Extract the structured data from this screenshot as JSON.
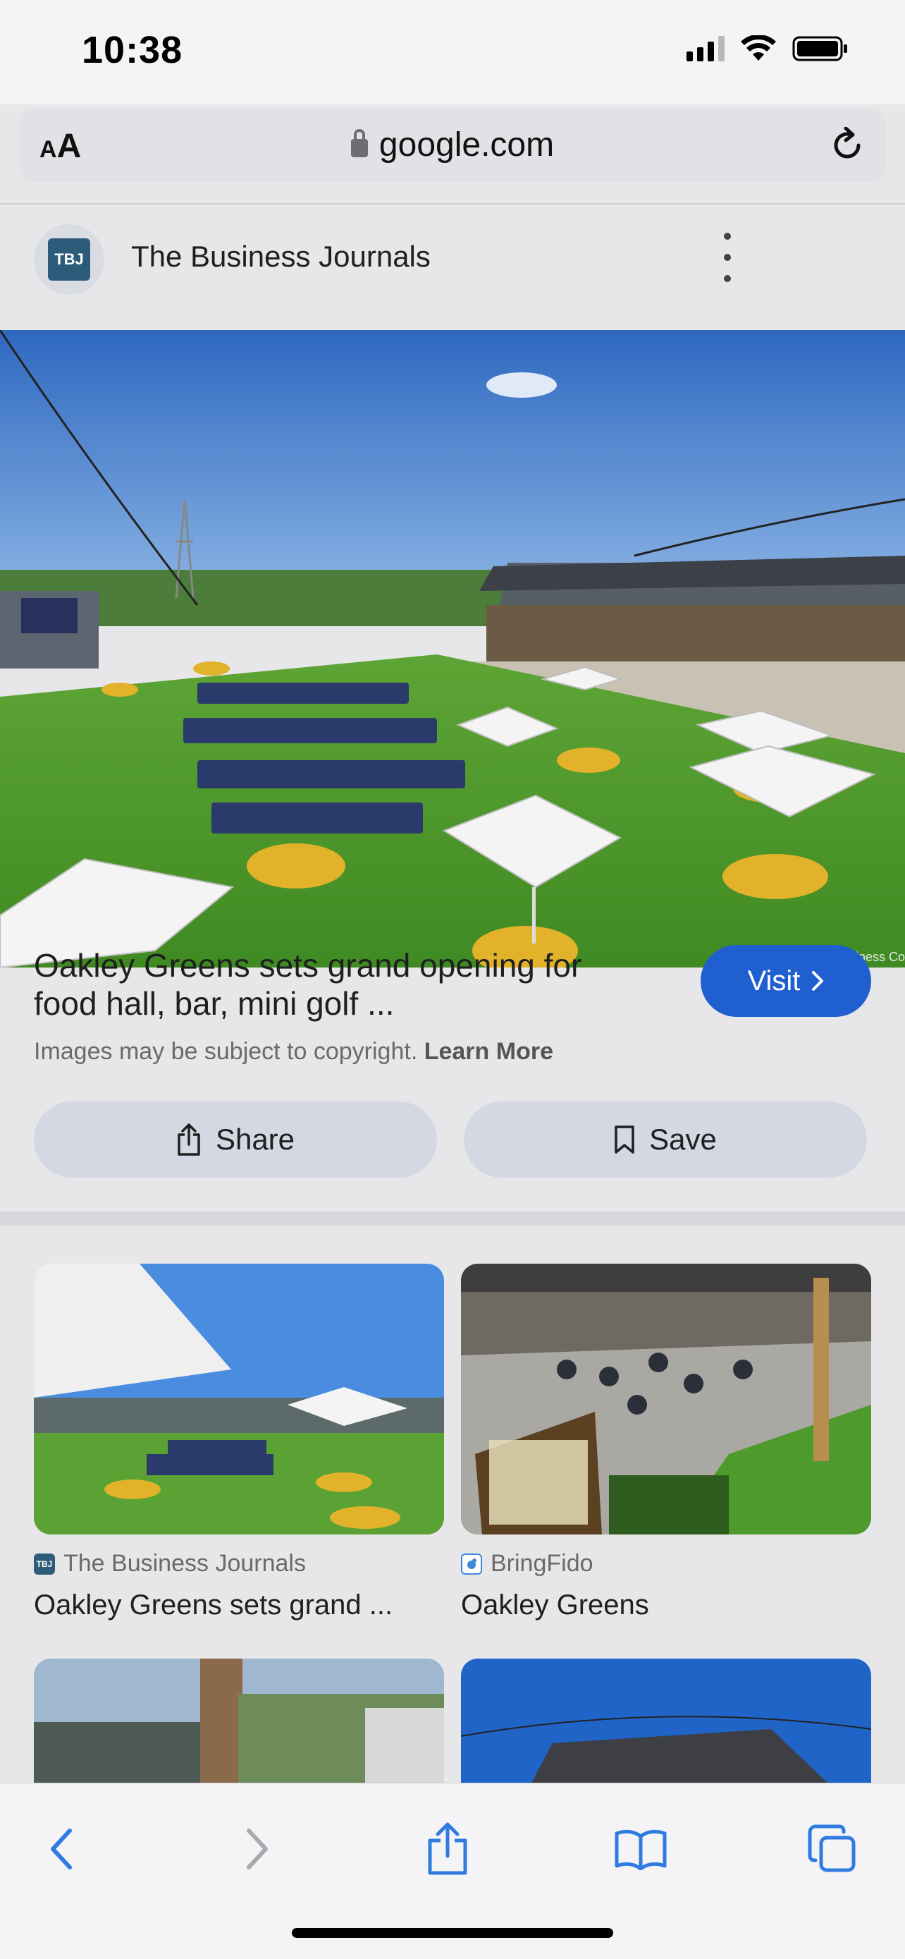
{
  "status_bar": {
    "time": "10:38"
  },
  "browser": {
    "text_size_label": "AA",
    "url": "google.com"
  },
  "source": {
    "logo_text": "TBJ",
    "name": "The Business Journals"
  },
  "hero": {
    "credit": "Image: Cincinnati Business Co"
  },
  "result": {
    "title_line1_partial": "Oakley Greens sets grand opening for",
    "title_line2": "food hall, bar, mini golf ...",
    "visit_label": "Visit",
    "copyright_text": "Images may be subject to copyright.",
    "learn_more": "Learn More",
    "share_label": "Share",
    "save_label": "Save"
  },
  "related": [
    {
      "source": "The Business Journals",
      "favicon": "TBJ",
      "title": "Oakley Greens sets grand ..."
    },
    {
      "source": "BringFido",
      "favicon": "dog-icon",
      "title": "Oakley Greens"
    }
  ],
  "colors": {
    "accent": "#1f5fd0",
    "toolbar_blue": "#2f7be0",
    "toolbar_disabled": "#a9a9ad"
  }
}
